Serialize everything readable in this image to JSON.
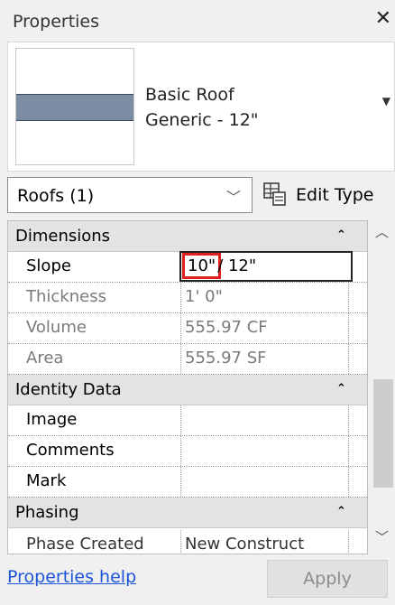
{
  "window": {
    "title": "Properties",
    "close_icon": "close-icon"
  },
  "type_selector": {
    "line1": "Basic Roof",
    "line2": "Generic - 12\""
  },
  "instance_filter": {
    "value": "Roofs (1)",
    "edit_type_label": "Edit Type"
  },
  "sections": [
    {
      "title": "Dimensions",
      "rows": [
        {
          "name": "Slope",
          "value_highlight": "10\"",
          "value_rest": "/ 12\""
        },
        {
          "name": "Thickness",
          "value": "1'  0\""
        },
        {
          "name": "Volume",
          "value": "555.97 CF"
        },
        {
          "name": "Area",
          "value": "555.97 SF"
        }
      ]
    },
    {
      "title": "Identity Data",
      "rows": [
        {
          "name": "Image",
          "value": ""
        },
        {
          "name": "Comments",
          "value": ""
        },
        {
          "name": "Mark",
          "value": ""
        }
      ]
    },
    {
      "title": "Phasing",
      "rows": [
        {
          "name": "Phase Created",
          "value": "New Construct"
        }
      ]
    }
  ],
  "footer": {
    "help_link": "Properties help",
    "apply_label": "Apply"
  },
  "colors": {
    "highlight": "#e02020",
    "link": "#1a54d8",
    "swatch": "#7a8da3"
  }
}
